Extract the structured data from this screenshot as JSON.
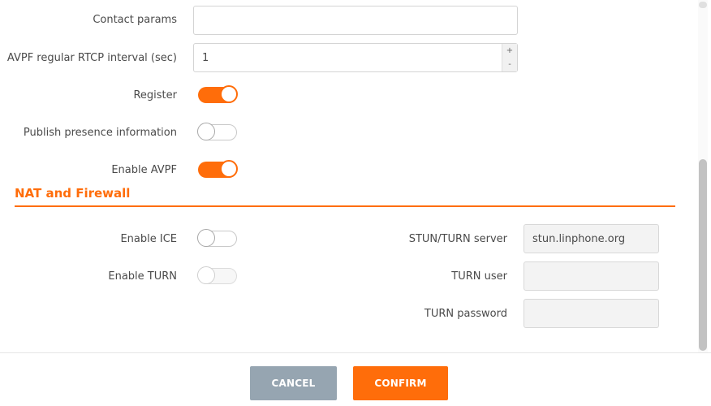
{
  "sip_settings": {
    "contact_params": {
      "label": "Contact params",
      "value": ""
    },
    "avpf_interval": {
      "label": "AVPF regular RTCP interval (sec)",
      "value": "1",
      "inc": "+",
      "dec": "-"
    },
    "register": {
      "label": "Register",
      "enabled": true
    },
    "publish_presence": {
      "label": "Publish presence information",
      "enabled": false
    },
    "enable_avpf": {
      "label": "Enable AVPF",
      "enabled": true
    }
  },
  "nat_firewall": {
    "title": "NAT and Firewall",
    "enable_ice": {
      "label": "Enable ICE",
      "enabled": false
    },
    "enable_turn": {
      "label": "Enable TURN",
      "enabled": false,
      "disabled": true
    },
    "stun_turn_server": {
      "label": "STUN/TURN server",
      "value": "stun.linphone.org"
    },
    "turn_user": {
      "label": "TURN user",
      "value": ""
    },
    "turn_password": {
      "label": "TURN password",
      "value": ""
    }
  },
  "footer": {
    "cancel_label": "CANCEL",
    "confirm_label": "CONFIRM"
  },
  "colors": {
    "accent": "#ff6d0a",
    "cancel": "#96a5b1"
  }
}
